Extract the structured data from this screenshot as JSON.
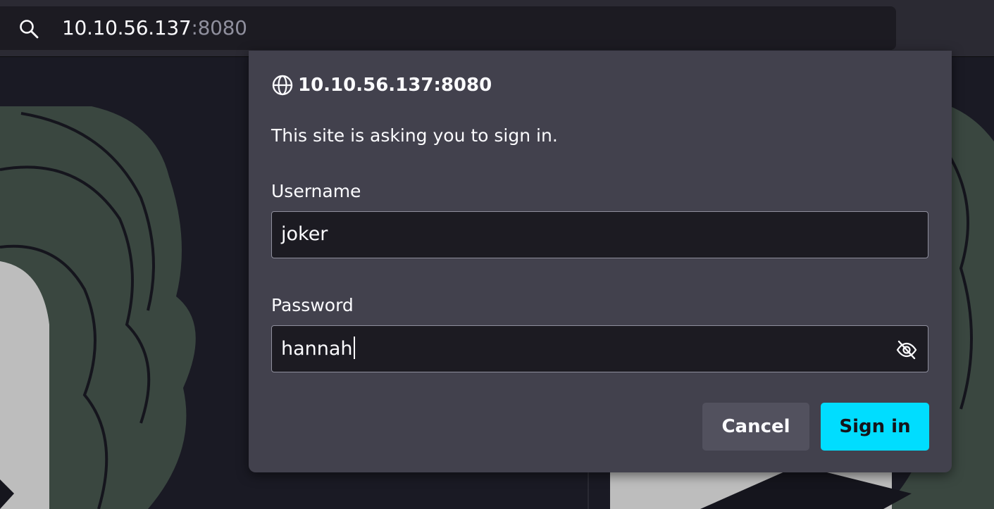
{
  "urlbar": {
    "host": "10.10.56.137",
    "port": ":8080",
    "search_icon": "search-icon"
  },
  "dialog": {
    "origin": "10.10.56.137:8080",
    "origin_icon": "globe-icon",
    "message": "This site is asking you to sign in.",
    "username_label": "Username",
    "username_value": "joker",
    "password_label": "Password",
    "password_value": "hannah",
    "reveal_icon": "eye-slash-icon",
    "cancel_label": "Cancel",
    "signin_label": "Sign in"
  },
  "colors": {
    "accent": "#00ddff",
    "dialog_bg": "#42414d",
    "field_bg": "#1c1b22"
  }
}
